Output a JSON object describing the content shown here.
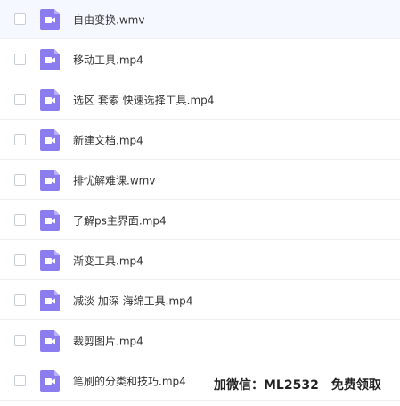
{
  "colors": {
    "icon_purple": "#8b7cf0",
    "icon_fold": "#b9afff",
    "highlight_row": "#f5f9ff"
  },
  "files": [
    {
      "name": "自由变换.wmv",
      "icon": "video-file-icon"
    },
    {
      "name": "移动工具.mp4",
      "icon": "video-file-icon"
    },
    {
      "name": "选区 套索 快速选择工具.mp4",
      "icon": "video-file-icon"
    },
    {
      "name": "新建文档.mp4",
      "icon": "video-file-icon"
    },
    {
      "name": "排忧解难课.wmv",
      "icon": "video-file-icon"
    },
    {
      "name": "了解ps主界面.mp4",
      "icon": "video-file-icon"
    },
    {
      "name": "渐变工具.mp4",
      "icon": "video-file-icon"
    },
    {
      "name": "减淡 加深 海绵工具.mp4",
      "icon": "video-file-icon"
    },
    {
      "name": "裁剪图片.mp4",
      "icon": "video-file-icon"
    },
    {
      "name": "笔刷的分类和技巧.mp4",
      "icon": "video-file-icon"
    }
  ],
  "watermark": "加微信：ML2532　免费领取"
}
